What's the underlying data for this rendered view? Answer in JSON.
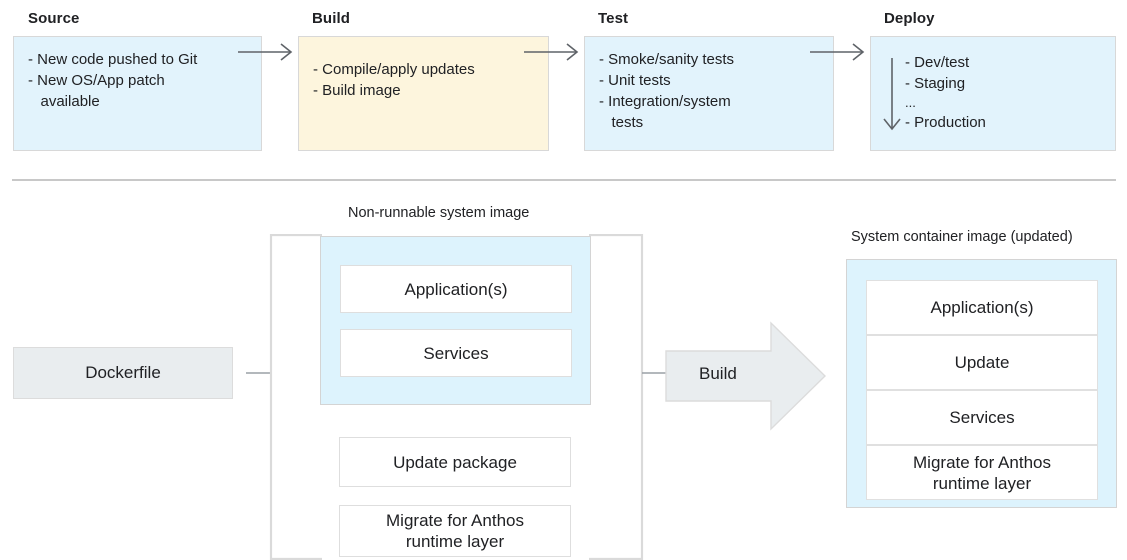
{
  "pipeline": {
    "stages": [
      {
        "title": "Source",
        "fill": "#e2f3fc",
        "items": [
          "- New code pushed to Git",
          "- New OS/App patch",
          "   available"
        ]
      },
      {
        "title": "Build",
        "fill": "#fdf5dd",
        "items": [
          "- Compile/apply updates",
          "- Build image"
        ]
      },
      {
        "title": "Test",
        "fill": "#e2f3fc",
        "items": [
          "- Smoke/sanity tests",
          "- Unit tests",
          "- Integration/system",
          "   tests"
        ]
      },
      {
        "title": "Deploy",
        "fill": "#e2f3fc",
        "items": [
          "- Dev/test",
          "- Staging",
          "...",
          "- Production"
        ]
      }
    ],
    "arrow_icons": [
      "arrow-right-icon",
      "arrow-right-icon",
      "arrow-right-icon"
    ],
    "deploy_progress_icon": "arrow-down-icon"
  },
  "build_flow": {
    "dockerfile": {
      "label": "Dockerfile"
    },
    "bracket_group": {
      "caption": "Non-runnable system image",
      "image_panel": {
        "layers": [
          "Application(s)",
          "Services"
        ]
      },
      "extra_boxes": [
        "Update package",
        "Migrate for Anthos\nruntime layer"
      ]
    },
    "build_arrow": {
      "label": "Build",
      "icon": "block-arrow-right-icon"
    },
    "result": {
      "caption": "System container image (updated)",
      "layers": [
        "Application(s)",
        "Update",
        "Services",
        "Migrate for Anthos\nruntime layer"
      ]
    }
  },
  "colors": {
    "blue_fill": "#e2f3fc",
    "blue_panel": "#ddf3fd",
    "cream_fill": "#fdf5dd",
    "grey_fill": "#e9edef",
    "border": "#d8d8d8",
    "divider": "#c8c8c8",
    "text": "#202124",
    "line": "#9aa0a6"
  }
}
